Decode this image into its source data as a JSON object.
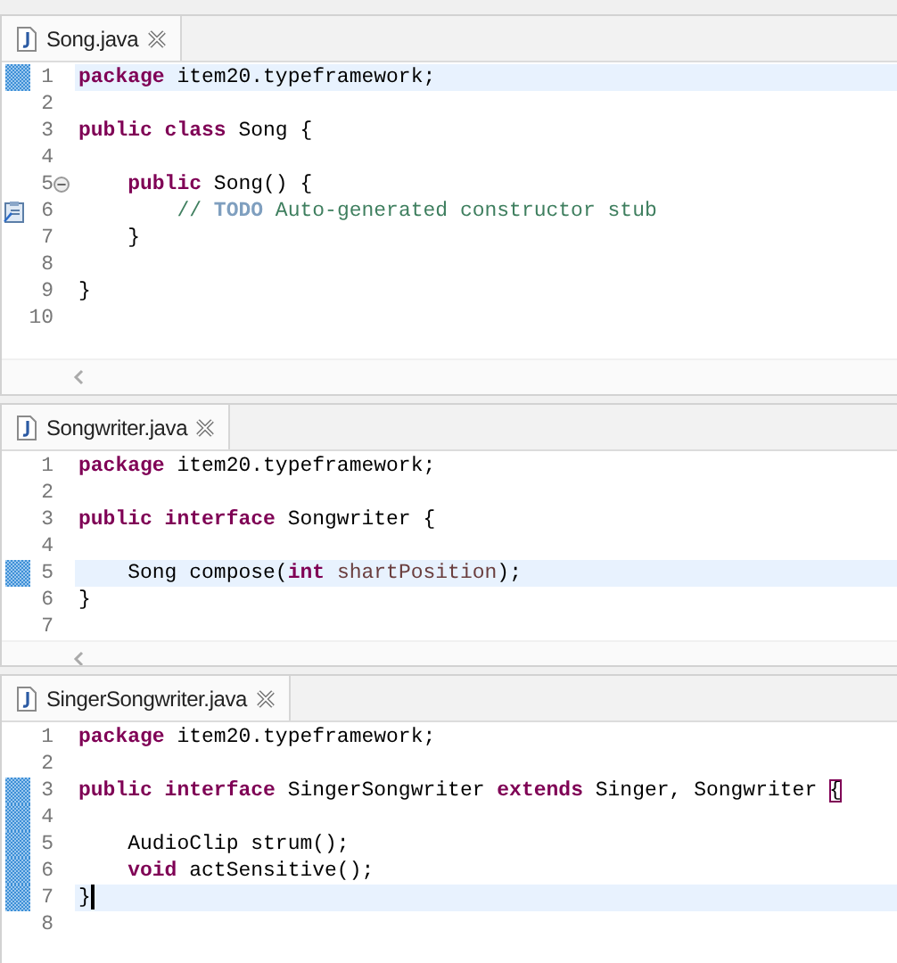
{
  "editors": [
    {
      "tab": {
        "title": "Song.java"
      },
      "scrollbar": true,
      "lines": [
        {
          "number": "1",
          "current": true,
          "changed": true,
          "segments": [
            {
              "kind": "keyword",
              "text": "package"
            },
            {
              "kind": "plain",
              "text": " item20.typeframework;"
            }
          ]
        },
        {
          "number": "2",
          "current": false,
          "changed": false
        },
        {
          "number": "3",
          "current": false,
          "changed": false,
          "segments": [
            {
              "kind": "keyword",
              "text": "public class"
            },
            {
              "kind": "plain",
              "text": " Song {"
            }
          ]
        },
        {
          "number": "4",
          "current": false,
          "changed": false
        },
        {
          "number": "5",
          "current": false,
          "changed": false,
          "foldable": true,
          "segments": [
            {
              "kind": "keyword",
              "text": "    public"
            },
            {
              "kind": "plain",
              "text": " Song() {"
            }
          ]
        },
        {
          "number": "6",
          "current": false,
          "changed": false,
          "task": true,
          "segments": [
            {
              "kind": "comment",
              "text": "        // "
            },
            {
              "kind": "todo",
              "text": "TODO"
            },
            {
              "kind": "comment",
              "text": " Auto-generated constructor stub"
            }
          ]
        },
        {
          "number": "7",
          "current": false,
          "changed": false,
          "segments": [
            {
              "kind": "plain",
              "text": "    }"
            }
          ]
        },
        {
          "number": "8",
          "current": false,
          "changed": false
        },
        {
          "number": "9",
          "current": false,
          "changed": false,
          "segments": [
            {
              "kind": "plain",
              "text": "}"
            }
          ]
        },
        {
          "number": "10",
          "current": false,
          "changed": false
        }
      ]
    },
    {
      "tab": {
        "title": "Songwriter.java"
      },
      "scrollbar": true,
      "lines": [
        {
          "number": "1",
          "current": false,
          "changed": false,
          "segments": [
            {
              "kind": "keyword",
              "text": "package"
            },
            {
              "kind": "plain",
              "text": " item20.typeframework;"
            }
          ]
        },
        {
          "number": "2",
          "current": false,
          "changed": false
        },
        {
          "number": "3",
          "current": false,
          "changed": false,
          "segments": [
            {
              "kind": "keyword",
              "text": "public interface"
            },
            {
              "kind": "plain",
              "text": " Songwriter {"
            }
          ]
        },
        {
          "number": "4",
          "current": false,
          "changed": false
        },
        {
          "number": "5",
          "current": true,
          "changed": true,
          "segments": [
            {
              "kind": "plain",
              "text": "    Song compose("
            },
            {
              "kind": "keyword",
              "text": "int"
            },
            {
              "kind": "param",
              "text": " shartPosition"
            },
            {
              "kind": "plain",
              "text": ");"
            }
          ]
        },
        {
          "number": "6",
          "current": false,
          "changed": false,
          "segments": [
            {
              "kind": "plain",
              "text": "}"
            }
          ]
        },
        {
          "number": "7",
          "current": false,
          "changed": false
        }
      ]
    },
    {
      "tab": {
        "title": "SingerSongwriter.java"
      },
      "scrollbar": false,
      "lines": [
        {
          "number": "1",
          "current": false,
          "changed": false,
          "segments": [
            {
              "kind": "keyword",
              "text": "package"
            },
            {
              "kind": "plain",
              "text": " item20.typeframework;"
            }
          ]
        },
        {
          "number": "2",
          "current": false,
          "changed": false
        },
        {
          "number": "3",
          "current": false,
          "changed": true,
          "segments": [
            {
              "kind": "keyword",
              "text": "public interface"
            },
            {
              "kind": "plain",
              "text": " SingerSongwriter "
            },
            {
              "kind": "keyword",
              "text": "extends"
            },
            {
              "kind": "plain",
              "text": " Singer, Songwriter "
            },
            {
              "kind": "bracket",
              "text": "{"
            }
          ]
        },
        {
          "number": "4",
          "current": false,
          "changed": true
        },
        {
          "number": "5",
          "current": false,
          "changed": true,
          "segments": [
            {
              "kind": "plain",
              "text": "    AudioClip strum();"
            }
          ]
        },
        {
          "number": "6",
          "current": false,
          "changed": true,
          "segments": [
            {
              "kind": "keyword",
              "text": "    void"
            },
            {
              "kind": "plain",
              "text": " actSensitive();"
            }
          ]
        },
        {
          "number": "7",
          "current": true,
          "changed": true,
          "cursor": true,
          "segments": [
            {
              "kind": "plain",
              "text": "}"
            }
          ]
        },
        {
          "number": "8",
          "current": false,
          "changed": false
        }
      ]
    }
  ]
}
